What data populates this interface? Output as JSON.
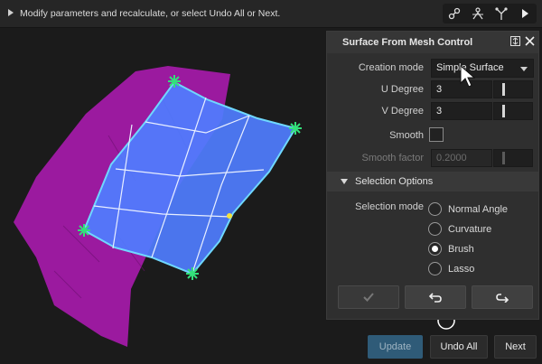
{
  "topbar": {
    "message": "Modify parameters and recalculate, or select Undo All or Next.",
    "tools": [
      "node-link-icon",
      "transform-icon",
      "branch-icon",
      "play-icon"
    ]
  },
  "panel": {
    "title": "Surface From Mesh Control",
    "creation_mode": {
      "label": "Creation mode",
      "value": "Simple Surface"
    },
    "u_degree": {
      "label": "U Degree",
      "value": "3"
    },
    "v_degree": {
      "label": "V Degree",
      "value": "3"
    },
    "smooth": {
      "label": "Smooth",
      "checked": false
    },
    "smooth_factor": {
      "label": "Smooth factor",
      "value": "0.2000",
      "disabled": true
    },
    "selection_section": "Selection Options",
    "selection_mode": {
      "label": "Selection mode",
      "options": [
        "Normal Angle",
        "Curvature",
        "Brush",
        "Lasso"
      ],
      "selected": "Brush"
    },
    "actions": [
      "accept-icon",
      "undo-icon",
      "redo-icon"
    ]
  },
  "buttons": {
    "update": "Update",
    "undo_all": "Undo All",
    "next": "Next"
  },
  "colors": {
    "mesh": "#a21aa6",
    "surface": "#4f7dff",
    "handle": "#33e07a",
    "accent": "#2f5b78"
  }
}
